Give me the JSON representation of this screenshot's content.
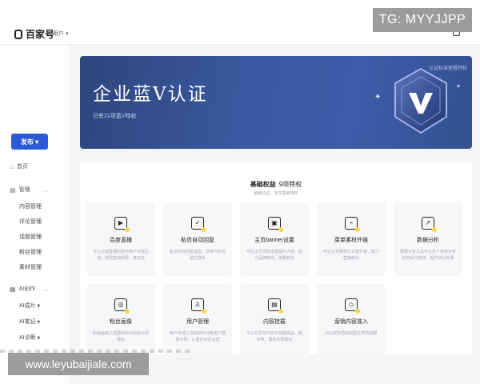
{
  "header": {
    "logo_text": "百家号",
    "account": "用户 ▾",
    "tg_badge": "TG: MYYJJPP"
  },
  "sidebar": {
    "publish_label": "发布 ▾",
    "home_label": "首页",
    "group_manage": "管理",
    "manage_items": [
      "内容管理",
      "评论管理",
      "话题管理",
      "粉丝管理",
      "素材管理"
    ],
    "group_ai": "AI创作",
    "ai_items": [
      "AI成片 ♦",
      "AI笔记 ♦",
      "AI诊断 ♦"
    ]
  },
  "hero": {
    "title": "企业蓝V认证",
    "subtitle": "已有21项蓝V特权",
    "links": [
      "认证标准",
      "查看特权"
    ]
  },
  "benefits": {
    "title_main": "基础权益",
    "title_count": "9项特权",
    "subtitle": "解锁认证，专享基础特权",
    "items": [
      {
        "icon": "▶",
        "name": "百度直播",
        "desc": "可以全面直播内容与用户在线互动，增强营销效果、真实性"
      },
      {
        "icon": "✓",
        "name": "私信自动回复",
        "desc": "私信自动回复消息，快速与粉丝建立联系"
      },
      {
        "icon": "▣",
        "name": "主页banner设置",
        "desc": "可在主页顶部设置图片内容，助力品牌曝光、流量转化"
      },
      {
        "icon": "⌁",
        "name": "菜单素材外链",
        "desc": "可在主页菜单栏设置外链，助力营销转化"
      },
      {
        "icon": "↗",
        "name": "数据分析",
        "desc": "数据分析工具可以多个维度分析您的受众群体、提升转化效果"
      },
      {
        "icon": "◎",
        "name": "粉丝画像",
        "desc": "粉丝画像工具帮助你识别受众的特征"
      },
      {
        "icon": "♙",
        "name": "用户管理",
        "desc": "用户管理工具帮助你分析用户群体分层，以便针对性运营"
      },
      {
        "icon": "▤",
        "name": "内容挂载",
        "desc": "可以在发布内容中挂载商品、服务等，帮助实现转化"
      },
      {
        "icon": "◇",
        "name": "营销内容准入",
        "desc": "可以发布营销类型文章的权限"
      }
    ]
  },
  "footer": {
    "watermark": "www.leyubaijiale.com"
  }
}
